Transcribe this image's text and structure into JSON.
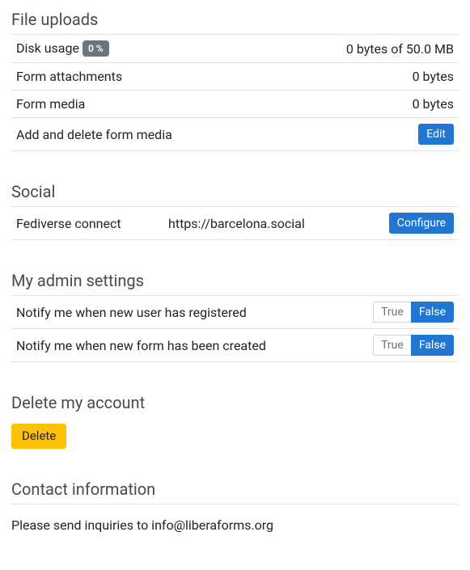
{
  "file_uploads": {
    "title": "File uploads",
    "rows": {
      "disk_usage_label": "Disk usage",
      "disk_usage_badge": "0 %",
      "disk_usage_value": "0 bytes of 50.0 MB",
      "form_attachments_label": "Form attachments",
      "form_attachments_value": "0 bytes",
      "form_media_label": "Form media",
      "form_media_value": "0 bytes",
      "add_delete_label": "Add and delete form media",
      "edit_btn": "Edit"
    }
  },
  "social": {
    "title": "Social",
    "fediverse_label": "Fediverse connect",
    "fediverse_url": "https://barcelona.social",
    "configure_btn": "Configure"
  },
  "admin": {
    "title": "My admin settings",
    "notify_user_label": "Notify me when new user has registered",
    "notify_form_label": "Notify me when new form has been created",
    "true_label": "True",
    "false_label": "False"
  },
  "delete_account": {
    "title": "Delete my account",
    "delete_btn": "Delete"
  },
  "contact": {
    "title": "Contact information",
    "text": "Please send inquiries to info@liberaforms.org"
  }
}
